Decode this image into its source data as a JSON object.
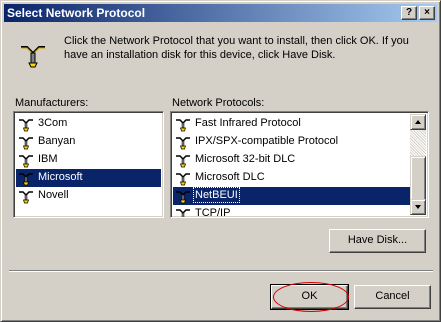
{
  "window": {
    "title": "Select Network Protocol",
    "help_label": "?",
    "close_label": "×"
  },
  "instructions": "Click the Network Protocol that you want to install, then click OK. If you have an installation disk for this device, click Have Disk.",
  "manufacturers": {
    "label": "Manufacturers:",
    "items": [
      {
        "label": "3Com",
        "selected": false
      },
      {
        "label": "Banyan",
        "selected": false
      },
      {
        "label": "IBM",
        "selected": false
      },
      {
        "label": "Microsoft",
        "selected": true
      },
      {
        "label": "Novell",
        "selected": false
      }
    ]
  },
  "protocols": {
    "label": "Network Protocols:",
    "items": [
      {
        "label": "Fast Infrared Protocol",
        "selected": false
      },
      {
        "label": "IPX/SPX-compatible Protocol",
        "selected": false
      },
      {
        "label": "Microsoft 32-bit DLC",
        "selected": false
      },
      {
        "label": "Microsoft DLC",
        "selected": false
      },
      {
        "label": "NetBEUI",
        "selected": true
      },
      {
        "label": "TCP/IP",
        "selected": false
      }
    ]
  },
  "buttons": {
    "have_disk": "Have Disk...",
    "ok": "OK",
    "cancel": "Cancel"
  },
  "colors": {
    "selection": "#0a246a",
    "highlight_circle": "#d40000"
  }
}
